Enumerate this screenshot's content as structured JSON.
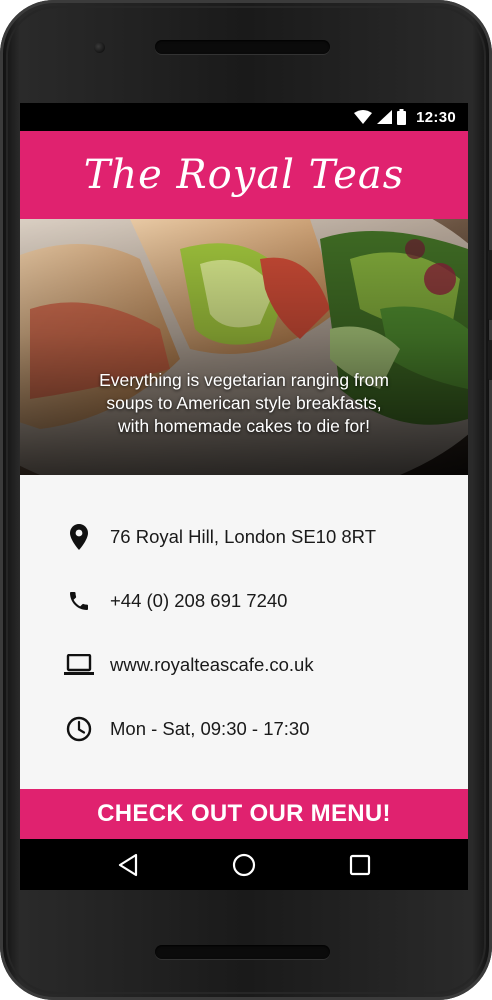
{
  "status_bar": {
    "time": "12:30",
    "icons": [
      "wifi-icon",
      "signal-icon",
      "battery-icon"
    ]
  },
  "header": {
    "title": "The Royal Teas"
  },
  "hero": {
    "tagline_lines": [
      "Everything is vegetarian ranging from",
      "soups to American style breakfasts,",
      "with homemade cakes to die for!"
    ]
  },
  "info": {
    "address": {
      "icon": "location-pin-icon",
      "text": "76 Royal Hill, London SE10 8RT"
    },
    "phone": {
      "icon": "phone-icon",
      "text": "+44 (0) 208 691 7240"
    },
    "website": {
      "icon": "laptop-icon",
      "text": "www.royalteascafe.co.uk"
    },
    "hours": {
      "icon": "clock-icon",
      "text": "Mon - Sat, 09:30 - 17:30"
    }
  },
  "cta": {
    "label": "CHECK OUT OUR MENU!"
  },
  "nav": {
    "buttons": [
      "back-icon",
      "home-icon",
      "recents-icon"
    ]
  },
  "colors": {
    "accent": "#e0226f",
    "status_bar": "#000000",
    "background": "#f6f6f6",
    "text": "#1a1a1a"
  }
}
